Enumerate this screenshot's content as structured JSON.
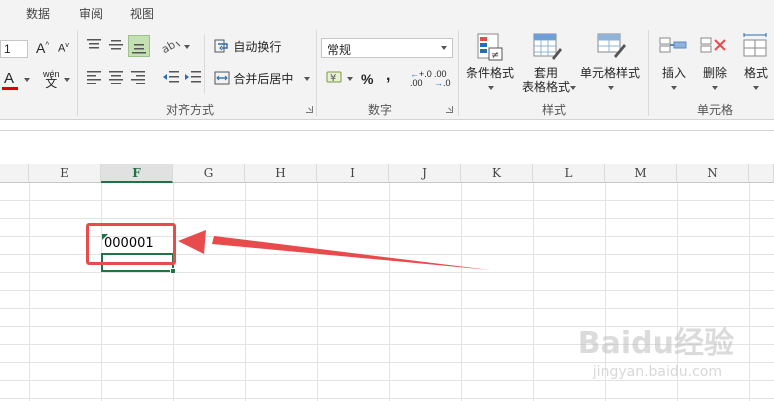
{
  "tabs": [
    "数据",
    "审阅",
    "视图"
  ],
  "ribbon": {
    "font": {
      "size_value": "1"
    },
    "alignment": {
      "wrap_text": "自动换行",
      "merge_center": "合并后居中",
      "group_label": "对齐方式"
    },
    "number": {
      "format_value": "常规",
      "currency_symbol": "¥",
      "percent": "%",
      "comma": ",",
      "increase_decimal": "+.0",
      "decrease_decimal": ".00",
      "group_label": "数字"
    },
    "styles": {
      "conditional_formatting": "条件格式",
      "format_as_table_1": "套用",
      "format_as_table_2": "表格格式",
      "cell_styles": "单元格样式",
      "group_label": "样式"
    },
    "cells": {
      "insert": "插入",
      "delete": "删除",
      "format": "格式",
      "group_label": "单元格"
    }
  },
  "grid": {
    "columns": [
      "E",
      "F",
      "G",
      "H",
      "I",
      "J",
      "K",
      "L",
      "M",
      "N"
    ],
    "active_column": "F",
    "cell_value": "000001"
  },
  "watermark": {
    "main": "Baidu经验",
    "sub": "jingyan.baidu.com"
  },
  "colors": {
    "accent": "#217346",
    "annotation": "#e84b4b"
  }
}
